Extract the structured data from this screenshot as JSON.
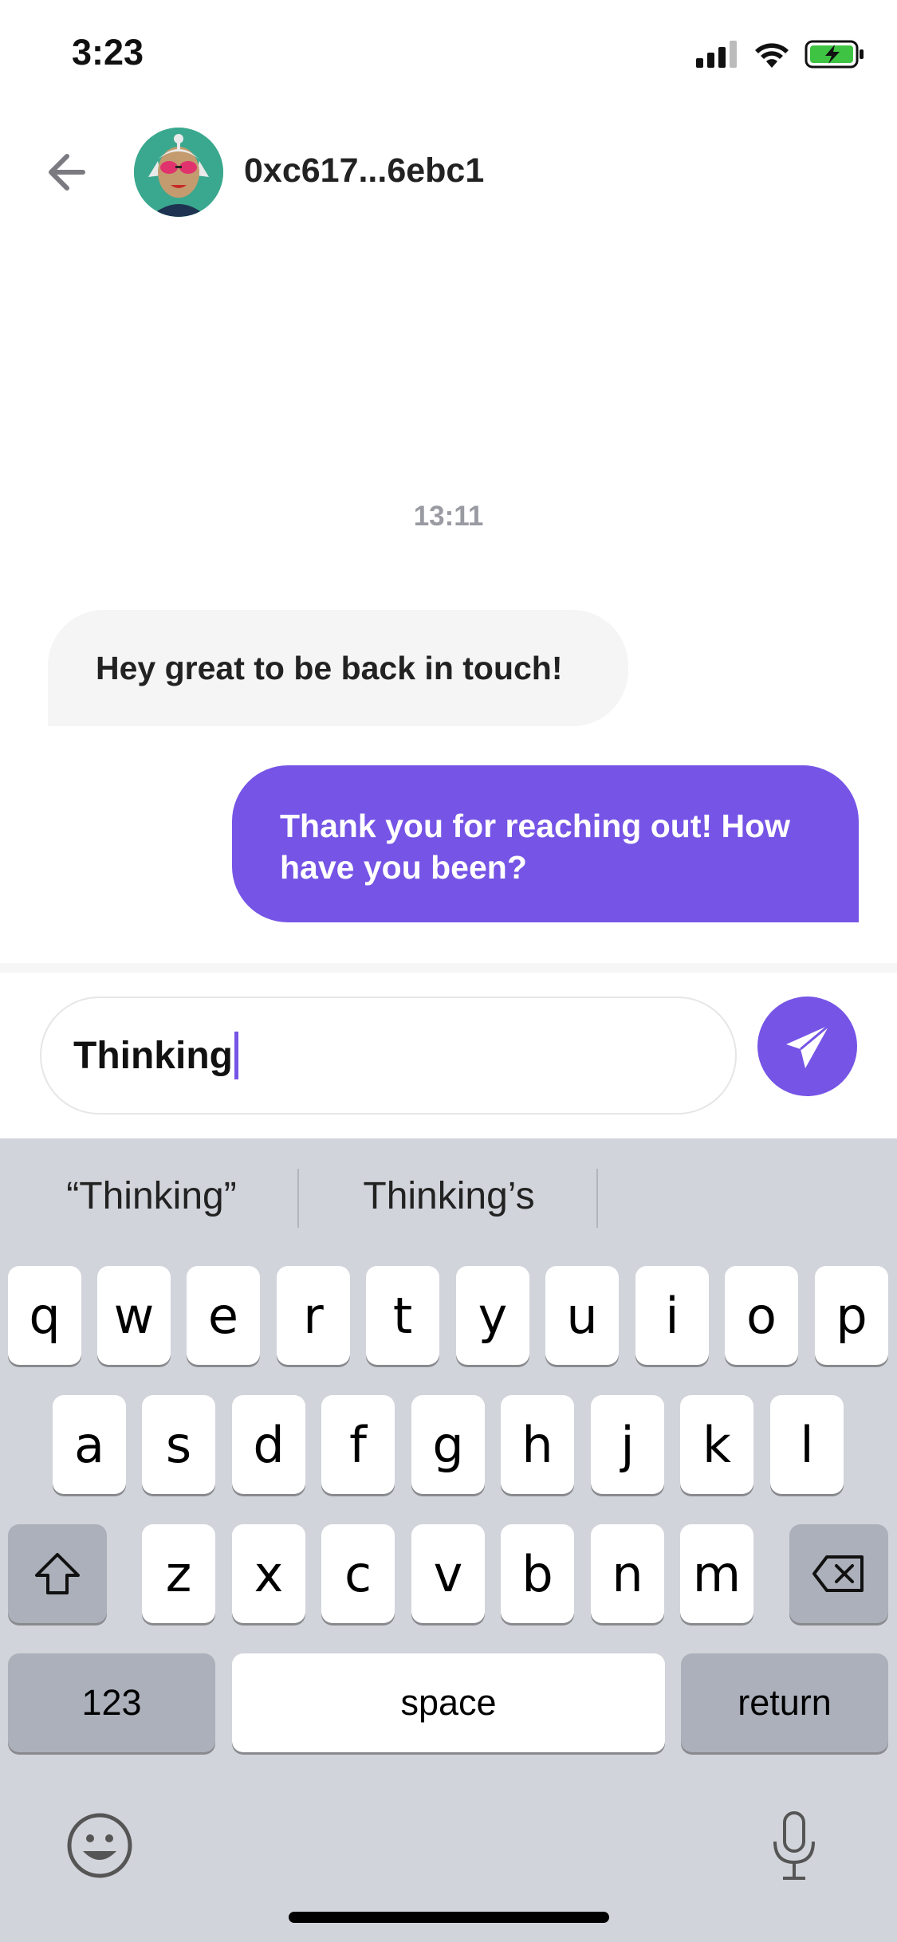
{
  "status_bar": {
    "time": "3:23"
  },
  "header": {
    "contact_name": "0xc617...6ebc1"
  },
  "conversation": {
    "timestamp": "13:11",
    "messages": [
      {
        "direction": "incoming",
        "text": "Hey great to be back in touch!"
      },
      {
        "direction": "outgoing",
        "text": "Thank you for reaching out! How have you been?"
      }
    ]
  },
  "composer": {
    "input_value": "Thinking"
  },
  "keyboard": {
    "suggestions": [
      "“Thinking”",
      "Thinking’s"
    ],
    "row1": [
      "q",
      "w",
      "e",
      "r",
      "t",
      "y",
      "u",
      "i",
      "o",
      "p"
    ],
    "row2": [
      "a",
      "s",
      "d",
      "f",
      "g",
      "h",
      "j",
      "k",
      "l"
    ],
    "row3": [
      "z",
      "x",
      "c",
      "v",
      "b",
      "n",
      "m"
    ],
    "numbers_label": "123",
    "space_label": "space",
    "return_label": "return"
  },
  "colors": {
    "accent": "#7554e6",
    "keyboard_bg": "#d1d4da"
  }
}
